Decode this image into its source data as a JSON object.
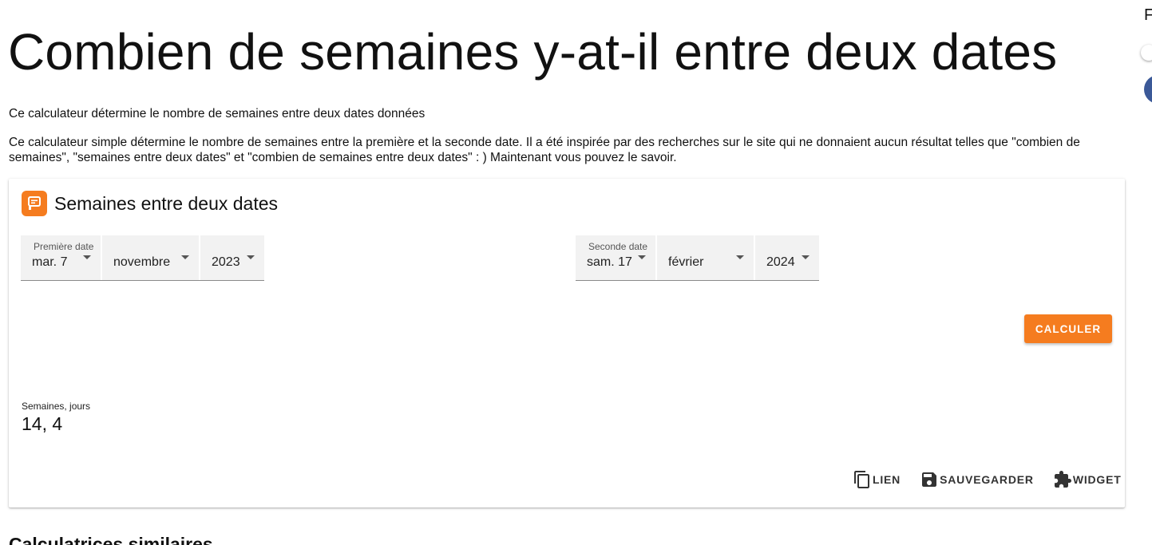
{
  "page": {
    "title": "Combien de semaines y-at-il entre deux dates",
    "intro": "Ce calculateur détermine le nombre de semaines entre deux dates données",
    "description": "Ce calculateur simple détermine le nombre de semaines entre la première et la seconde date. Il a été inspirée par des recherches sur le site qui ne donnaient aucun résultat telles que \"combien de semaines\", \"semaines entre deux dates\" et \"combien de semaines entre deux dates\" : ) Maintenant vous pouvez le savoir.",
    "similar_heading": "Calculatrices similaires",
    "right_edge_text": "F"
  },
  "calculator": {
    "title": "Semaines entre deux dates",
    "icon": "calculator-brand-icon",
    "first_date": {
      "label": "Première date",
      "day": "mar. 7",
      "month": "novembre",
      "year": "2023"
    },
    "second_date": {
      "label": "Seconde date",
      "day": "sam. 17",
      "month": "février",
      "year": "2024"
    },
    "calculate_label": "CALCULER",
    "result": {
      "label": "Semaines, jours",
      "value": "14, 4"
    },
    "actions": {
      "link": "LIEN",
      "save": "SAUVEGARDER",
      "widget": "WIDGET"
    }
  },
  "colors": {
    "accent": "#f57c1f",
    "facebook": "#3b5998"
  }
}
